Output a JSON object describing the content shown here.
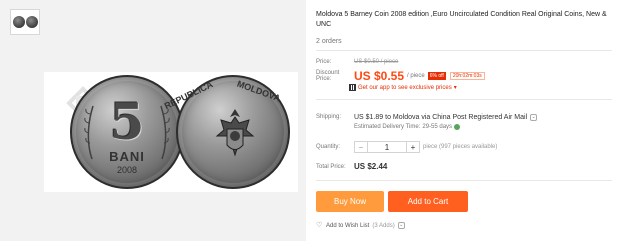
{
  "gallery": {
    "thumbnail_icon": "coin-thumbnail",
    "main_image_text": {
      "obverse": {
        "numeral": "5",
        "denomination": "BANI",
        "year": "2008"
      },
      "reverse": {
        "country_left": "REPUBLICA",
        "country_right": "MOLDOVA"
      }
    }
  },
  "product": {
    "title": "Moldova 5 Barney Coin 2008 edition ,Euro Uncirculated Condition Real Original Coins, New & UNC",
    "orders": "2 orders"
  },
  "pricing": {
    "price_label": "Price:",
    "old_price": "US $0.50 / piece",
    "discount_label": "Discount Price:",
    "new_price": "US $0.55",
    "unit": "/ piece",
    "off_badge": "6% off",
    "timer": "20h:02m:03s",
    "app_promo": "Get our app to see exclusive prices",
    "app_promo_caret": "▾"
  },
  "shipping": {
    "label": "Shipping:",
    "cost_text": "US $1.89 to Moldova via China Post Registered Air Mail",
    "caret": "⌄",
    "delivery_label": "Estimated Delivery Time:",
    "delivery_days": "29-55 days",
    "help_icon": "help-icon"
  },
  "quantity": {
    "label": "Quantity:",
    "minus": "−",
    "value": "1",
    "plus": "+",
    "available": "piece (997 pieces available)"
  },
  "total": {
    "label": "Total Price:",
    "value": "US $2.44"
  },
  "actions": {
    "buy_now": "Buy Now",
    "add_to_cart": "Add to Cart",
    "wishlist": "Add to Wish List",
    "wishlist_count": "(3 Adds)",
    "wishlist_caret": "⌄"
  },
  "colors": {
    "accent": "#ff4a14",
    "buy_button": "#ff9b3c",
    "cart_button": "#ff5f1f"
  }
}
